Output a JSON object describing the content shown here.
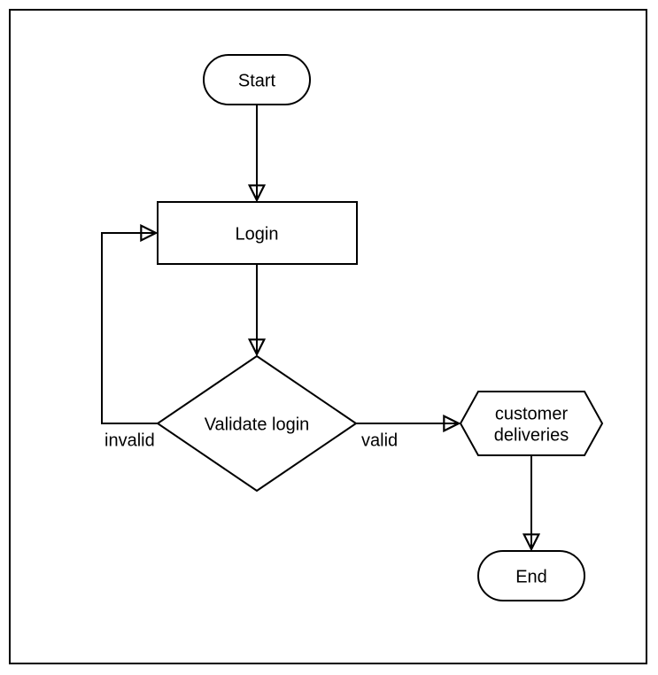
{
  "diagram": {
    "nodes": {
      "start": {
        "label": "Start",
        "type": "terminator"
      },
      "login": {
        "label": "Login",
        "type": "process"
      },
      "validate": {
        "label": "Validate login",
        "type": "decision"
      },
      "customer": {
        "label_line1": "customer",
        "label_line2": "deliveries",
        "type": "subprocess"
      },
      "end": {
        "label": "End",
        "type": "terminator"
      }
    },
    "edges": {
      "start_to_login": {
        "from": "start",
        "to": "login",
        "label": ""
      },
      "login_to_validate": {
        "from": "login",
        "to": "validate",
        "label": ""
      },
      "validate_to_login_invalid": {
        "from": "validate",
        "to": "login",
        "label": "invalid"
      },
      "validate_to_customer_valid": {
        "from": "validate",
        "to": "customer",
        "label": "valid"
      },
      "customer_to_end": {
        "from": "customer",
        "to": "end",
        "label": ""
      }
    }
  }
}
